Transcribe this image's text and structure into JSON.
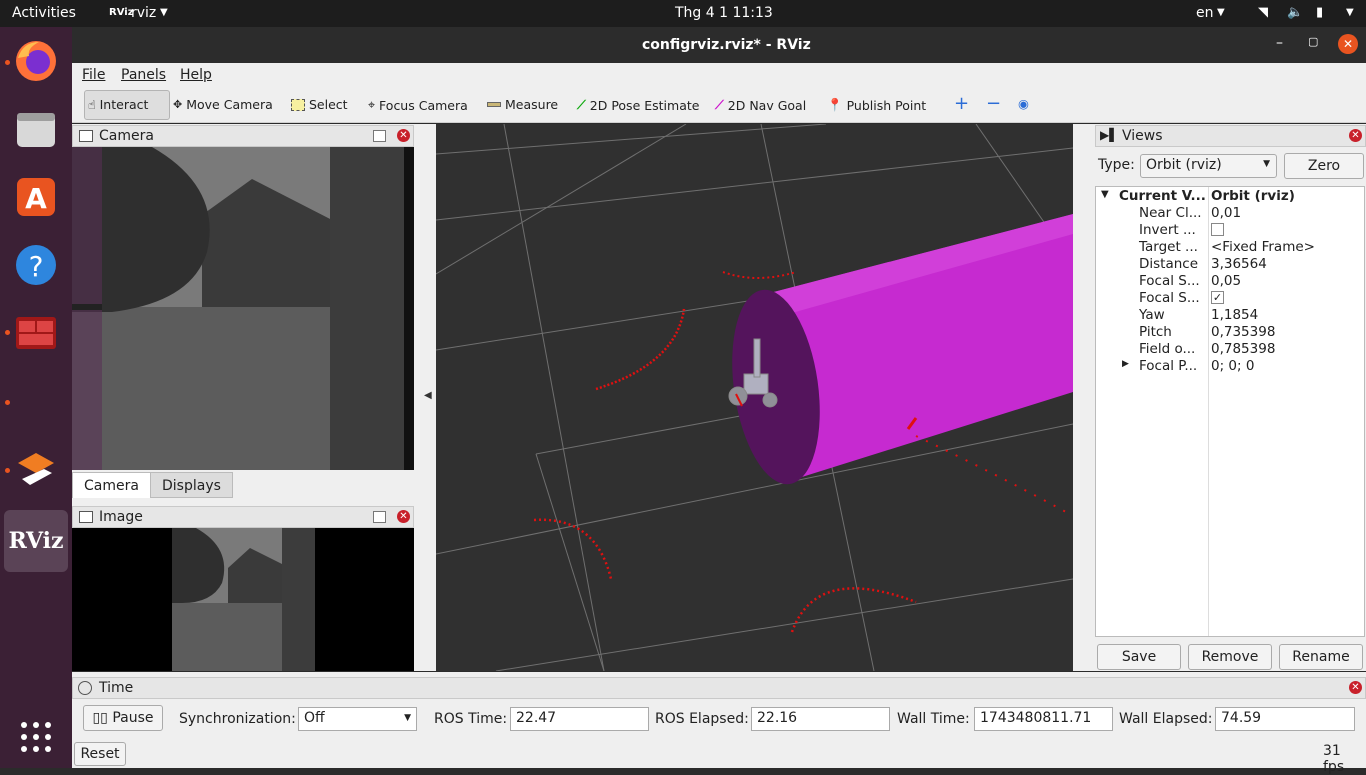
{
  "topbar": {
    "activities": "Activities",
    "app": "rviz",
    "clock": "Thg 4 1  11:13",
    "lang": "en"
  },
  "dock": {
    "rviz_label": "RViz"
  },
  "window": {
    "title": "configrviz.rviz* - RViz"
  },
  "menu": {
    "file": "File",
    "panels": "Panels",
    "help": "Help"
  },
  "toolbar": {
    "interact": "Interact",
    "move_camera": "Move Camera",
    "select": "Select",
    "focus_camera": "Focus Camera",
    "measure": "Measure",
    "pose_estimate": "2D Pose Estimate",
    "nav_goal": "2D Nav Goal",
    "publish_point": "Publish Point"
  },
  "camera_panel": {
    "title": "Camera"
  },
  "tabs": {
    "camera": "Camera",
    "displays": "Displays"
  },
  "image_panel": {
    "title": "Image"
  },
  "views": {
    "title": "Views",
    "type_label": "Type:",
    "type_value": "Orbit (rviz)",
    "zero": "Zero",
    "root_name": "Current V...",
    "root_value": "Orbit (rviz)",
    "props": [
      {
        "name": "Near Cl...",
        "value": "0,01"
      },
      {
        "name": "Invert ...",
        "value": ""
      },
      {
        "name": "Target ...",
        "value": "<Fixed Frame>"
      },
      {
        "name": "Distance",
        "value": "3,36564"
      },
      {
        "name": "Focal S...",
        "value": "0,05"
      },
      {
        "name": "Focal S...",
        "value": ""
      },
      {
        "name": "Yaw",
        "value": "1,1854"
      },
      {
        "name": "Pitch",
        "value": "0,735398"
      },
      {
        "name": "Field o...",
        "value": "0,785398"
      },
      {
        "name": "Focal P...",
        "value": "0; 0; 0"
      }
    ],
    "invert_checked": false,
    "focal_shape_checked": true,
    "save": "Save",
    "remove": "Remove",
    "rename": "Rename"
  },
  "time": {
    "title": "Time",
    "pause": "Pause",
    "sync_label": "Synchronization:",
    "sync_value": "Off",
    "ros_time_label": "ROS Time:",
    "ros_time": "22.47",
    "ros_elapsed_label": "ROS Elapsed:",
    "ros_elapsed": "22.16",
    "wall_time_label": "Wall Time:",
    "wall_time": "1743480811.71",
    "wall_elapsed_label": "Wall Elapsed:",
    "wall_elapsed": "74.59",
    "reset": "Reset",
    "fps": "31 fps"
  },
  "colors": {
    "cylinder": "#c020c8",
    "laser": "#e01010",
    "grid": "#8a8a8a",
    "viewport_bg": "#303030"
  }
}
